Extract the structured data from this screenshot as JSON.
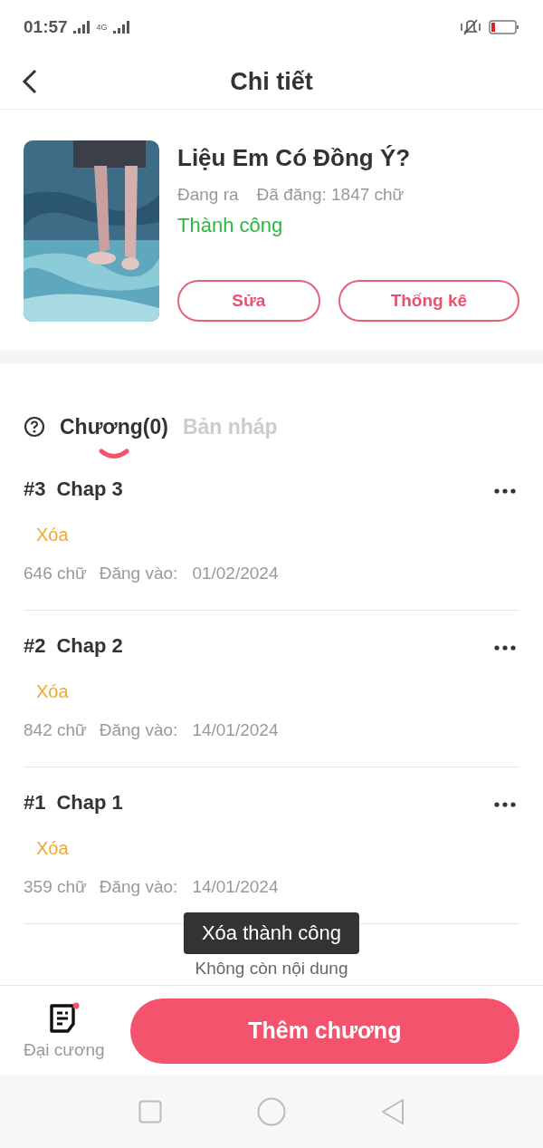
{
  "status_bar": {
    "time": "01:57",
    "network": "4G"
  },
  "header": {
    "title": "Chi tiết"
  },
  "book": {
    "title": "Liệu Em Có Đồng Ý?",
    "state": "Đang ra",
    "posted": "Đã đăng: 1847 chữ",
    "result": "Thành công",
    "buttons": [
      "Sửa",
      "Thống kê"
    ]
  },
  "tabs": [
    {
      "label": "Chương(0)",
      "selected": true
    },
    {
      "label": "Bản nháp",
      "selected": false
    }
  ],
  "chapters": [
    {
      "number": "#3",
      "title": "Chap 3",
      "action": "Xóa",
      "words": "646 chữ",
      "date_label": "Đăng vào:",
      "date": "01/02/2024"
    },
    {
      "number": "#2",
      "title": "Chap 2",
      "action": "Xóa",
      "words": "842 chữ",
      "date_label": "Đăng vào:",
      "date": "14/01/2024"
    },
    {
      "number": "#1",
      "title": "Chap 1",
      "action": "Xóa",
      "words": "359 chữ",
      "date_label": "Đăng vào:",
      "date": "14/01/2024"
    }
  ],
  "empty_text": "Không còn nội dung",
  "toast": "Xóa thành công",
  "bottom": {
    "outline_label": "Đại cương",
    "outline_notification": true,
    "add_button": "Thêm chương"
  }
}
